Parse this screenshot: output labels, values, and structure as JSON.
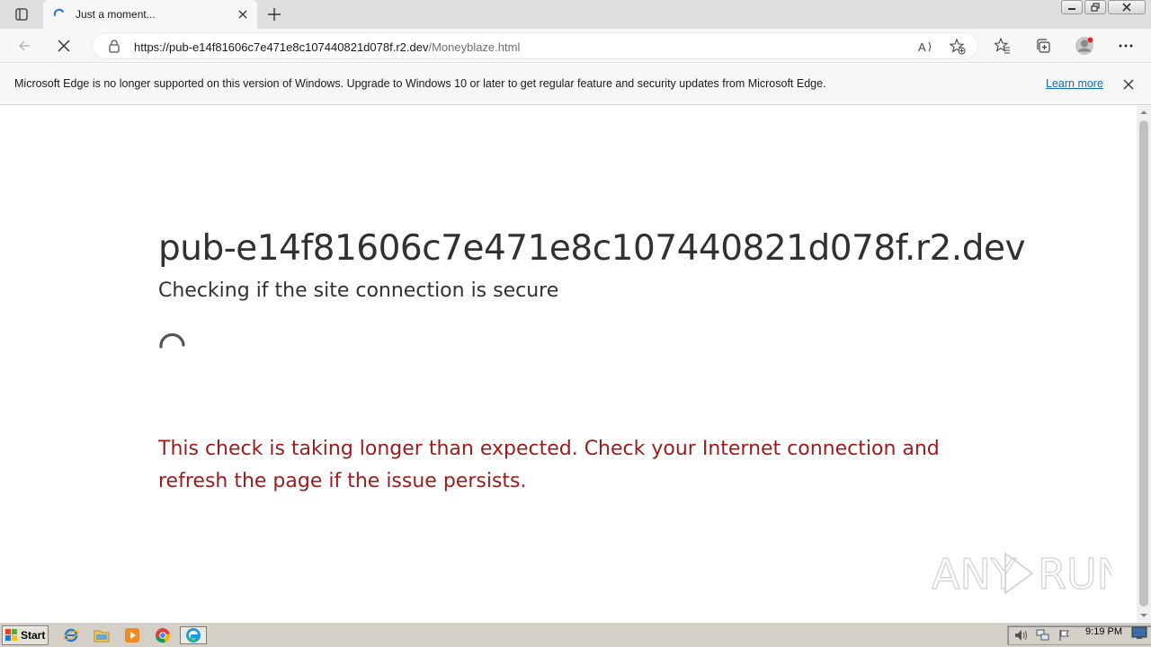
{
  "tab": {
    "title": "Just a moment...",
    "close_icon": "close-icon",
    "new_tab_icon": "plus-icon"
  },
  "address": {
    "url_host": "https://pub-e14f81606c7e471e8c107440821d078f.r2.dev",
    "url_path": "/Moneyblaze.html"
  },
  "infobar": {
    "message": "Microsoft Edge is no longer supported on this version of Windows. Upgrade to Windows 10 or later to get regular feature and security updates from Microsoft Edge.",
    "link": "Learn more"
  },
  "page": {
    "domain": "pub-e14f81606c7e471e8c107440821d078f.r2.dev",
    "subtitle": "Checking if the site connection is secure",
    "warning": "This check is taking longer than expected. Check your Internet connection and refresh the page if the issue persists."
  },
  "watermark": {
    "text": "ANY RUN"
  },
  "taskbar": {
    "start_label": "Start",
    "clock": "9:19 PM"
  },
  "colors": {
    "warning": "#9e1a1a",
    "heading": "#313131",
    "link": "#0f6cbd"
  }
}
